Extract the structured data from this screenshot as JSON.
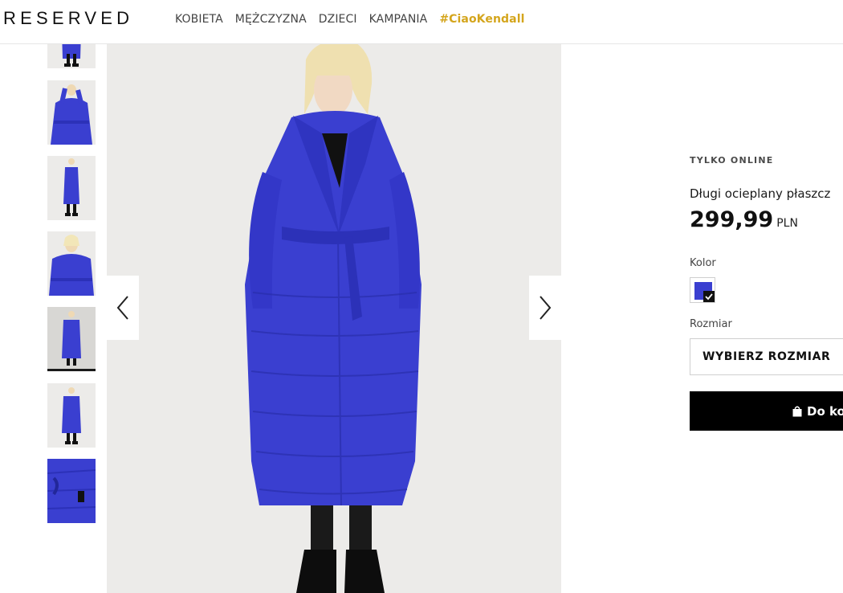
{
  "header": {
    "logo": "RESERVED",
    "nav": [
      "KOBIETA",
      "MĘŻCZYZNA",
      "DZIECI",
      "KAMPANIA"
    ],
    "nav_highlight": "#CiaoKendall"
  },
  "colors": {
    "coat_blue": "#3a3fd0",
    "highlight_gold": "#d4a51c",
    "button_black": "#000000"
  },
  "gallery": {
    "thumbnail_count": 7,
    "active_thumbnail": 5,
    "prev_icon": "chevron-left-icon",
    "next_icon": "chevron-right-icon"
  },
  "product": {
    "badge": "TYLKO ONLINE",
    "name": "Długi ocieplany płaszcz",
    "price": "299,99",
    "currency": "PLN",
    "color_label": "Kolor",
    "size_label": "Rozmiar",
    "size_placeholder": "WYBIERZ ROZMIAR",
    "add_to_cart": "Do koszyka",
    "cart_icon": "shopping-bag-icon"
  }
}
